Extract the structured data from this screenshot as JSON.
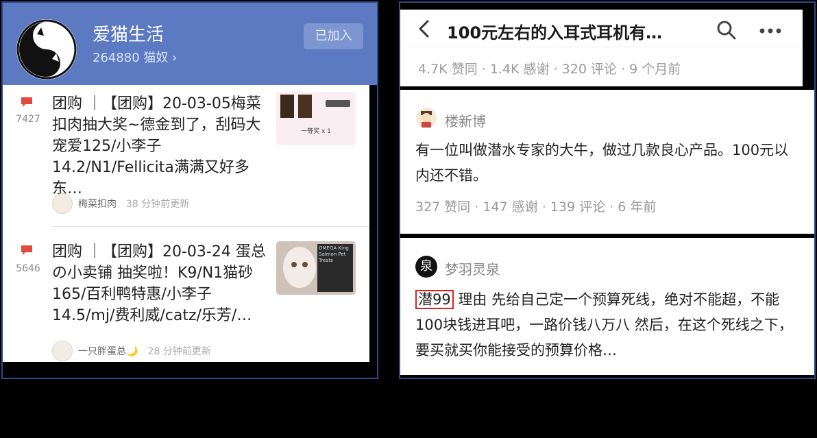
{
  "left": {
    "group": {
      "title": "爱猫生活",
      "subtitle": "264880 猫奴 ›",
      "joined_label": "已加入"
    },
    "posts": [
      {
        "count": "7427",
        "text": "团购 ｜【团购】20-03-05梅菜扣肉抽大奖~德金到了，刮码大宠爱125/小李子14.2/N1/Fellicita满满又好多东…",
        "author": "梅菜扣肉",
        "time": "38 分钟前更新",
        "thumb_caption": "一等奖 x 1"
      },
      {
        "count": "5646",
        "text": "团购 ｜【团购】20-03-24 蛋总の小卖铺 抽奖啦！K9/N1猫砂165/百利鸭特惠/小李子14.5/mj/费利威/catz/乐芳/…",
        "author": "一只胖蛋总🌙",
        "time": "28 分钟前更新",
        "thumb_caption": "OMEGA King Salmon Pet Treats"
      }
    ]
  },
  "right": {
    "question_title": "100元左右的入耳式耳机有…",
    "question_stats": "4.7K 赞同 · 1.4K 感谢 · 320 评论 · 9 个月前",
    "answers": [
      {
        "name": "楼新博",
        "text": "有一位叫做潜水专家的大牛，做过几款良心产品。100元以内还不错。",
        "stats": "327 赞同 · 147 感谢 · 139 评论 · 6 年前"
      },
      {
        "name": "梦羽灵泉",
        "avatar_char": "泉",
        "highlight": "潜99",
        "text": "理由 先给自己定一个预算死线，绝对不能超，不能100块钱进耳吧，一路价钱八万八 然后，在这个死线之下，要买就买你能接受的预算价格…"
      }
    ]
  },
  "colors": {
    "header_blue": "#5c7ac2",
    "flag_red": "#e04a3f",
    "highlight_red": "#e02020",
    "frame_blue": "#2e4a8a"
  }
}
